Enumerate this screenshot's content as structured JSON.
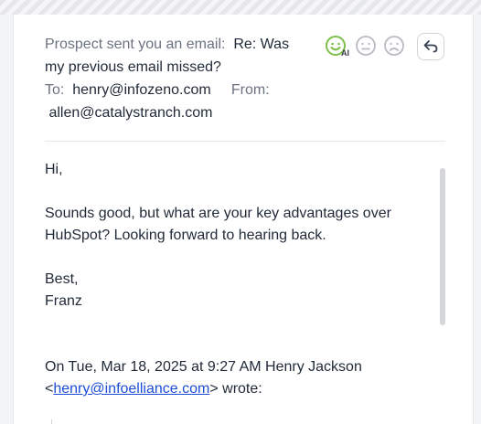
{
  "email": {
    "intro_label": "Prospect sent you an email:",
    "subject": "Re: Was my previous email missed?",
    "to_label": "To:",
    "to_address": "henry@infozeno.com",
    "from_label": "From:",
    "from_address": "allen@catalystranch.com",
    "body": {
      "greeting": "Hi,",
      "message": "Sounds good, but what are your key advantages over HubSpot? Looking forward to hearing back.",
      "closing": "Best,",
      "signature": "Franz",
      "quote_prefix": "On Tue, Mar 18, 2025 at 9:27 AM Henry Jackson",
      "quote_open": "<",
      "quote_email": "henry@infoelliance.com",
      "quote_suffix": "> wrote:"
    }
  },
  "sentiment": {
    "ai_badge": "AI",
    "options": [
      "positive-face-icon",
      "neutral-face-icon",
      "negative-face-icon"
    ],
    "selected": "positive",
    "selected_color": "#7cc04a",
    "inactive_color": "#b8bbc2"
  },
  "actions": {
    "reply_icon": "reply-arrow-icon"
  },
  "colors": {
    "link": "#1d4ed8",
    "muted_text": "#6b7280",
    "text": "#1f2937"
  }
}
